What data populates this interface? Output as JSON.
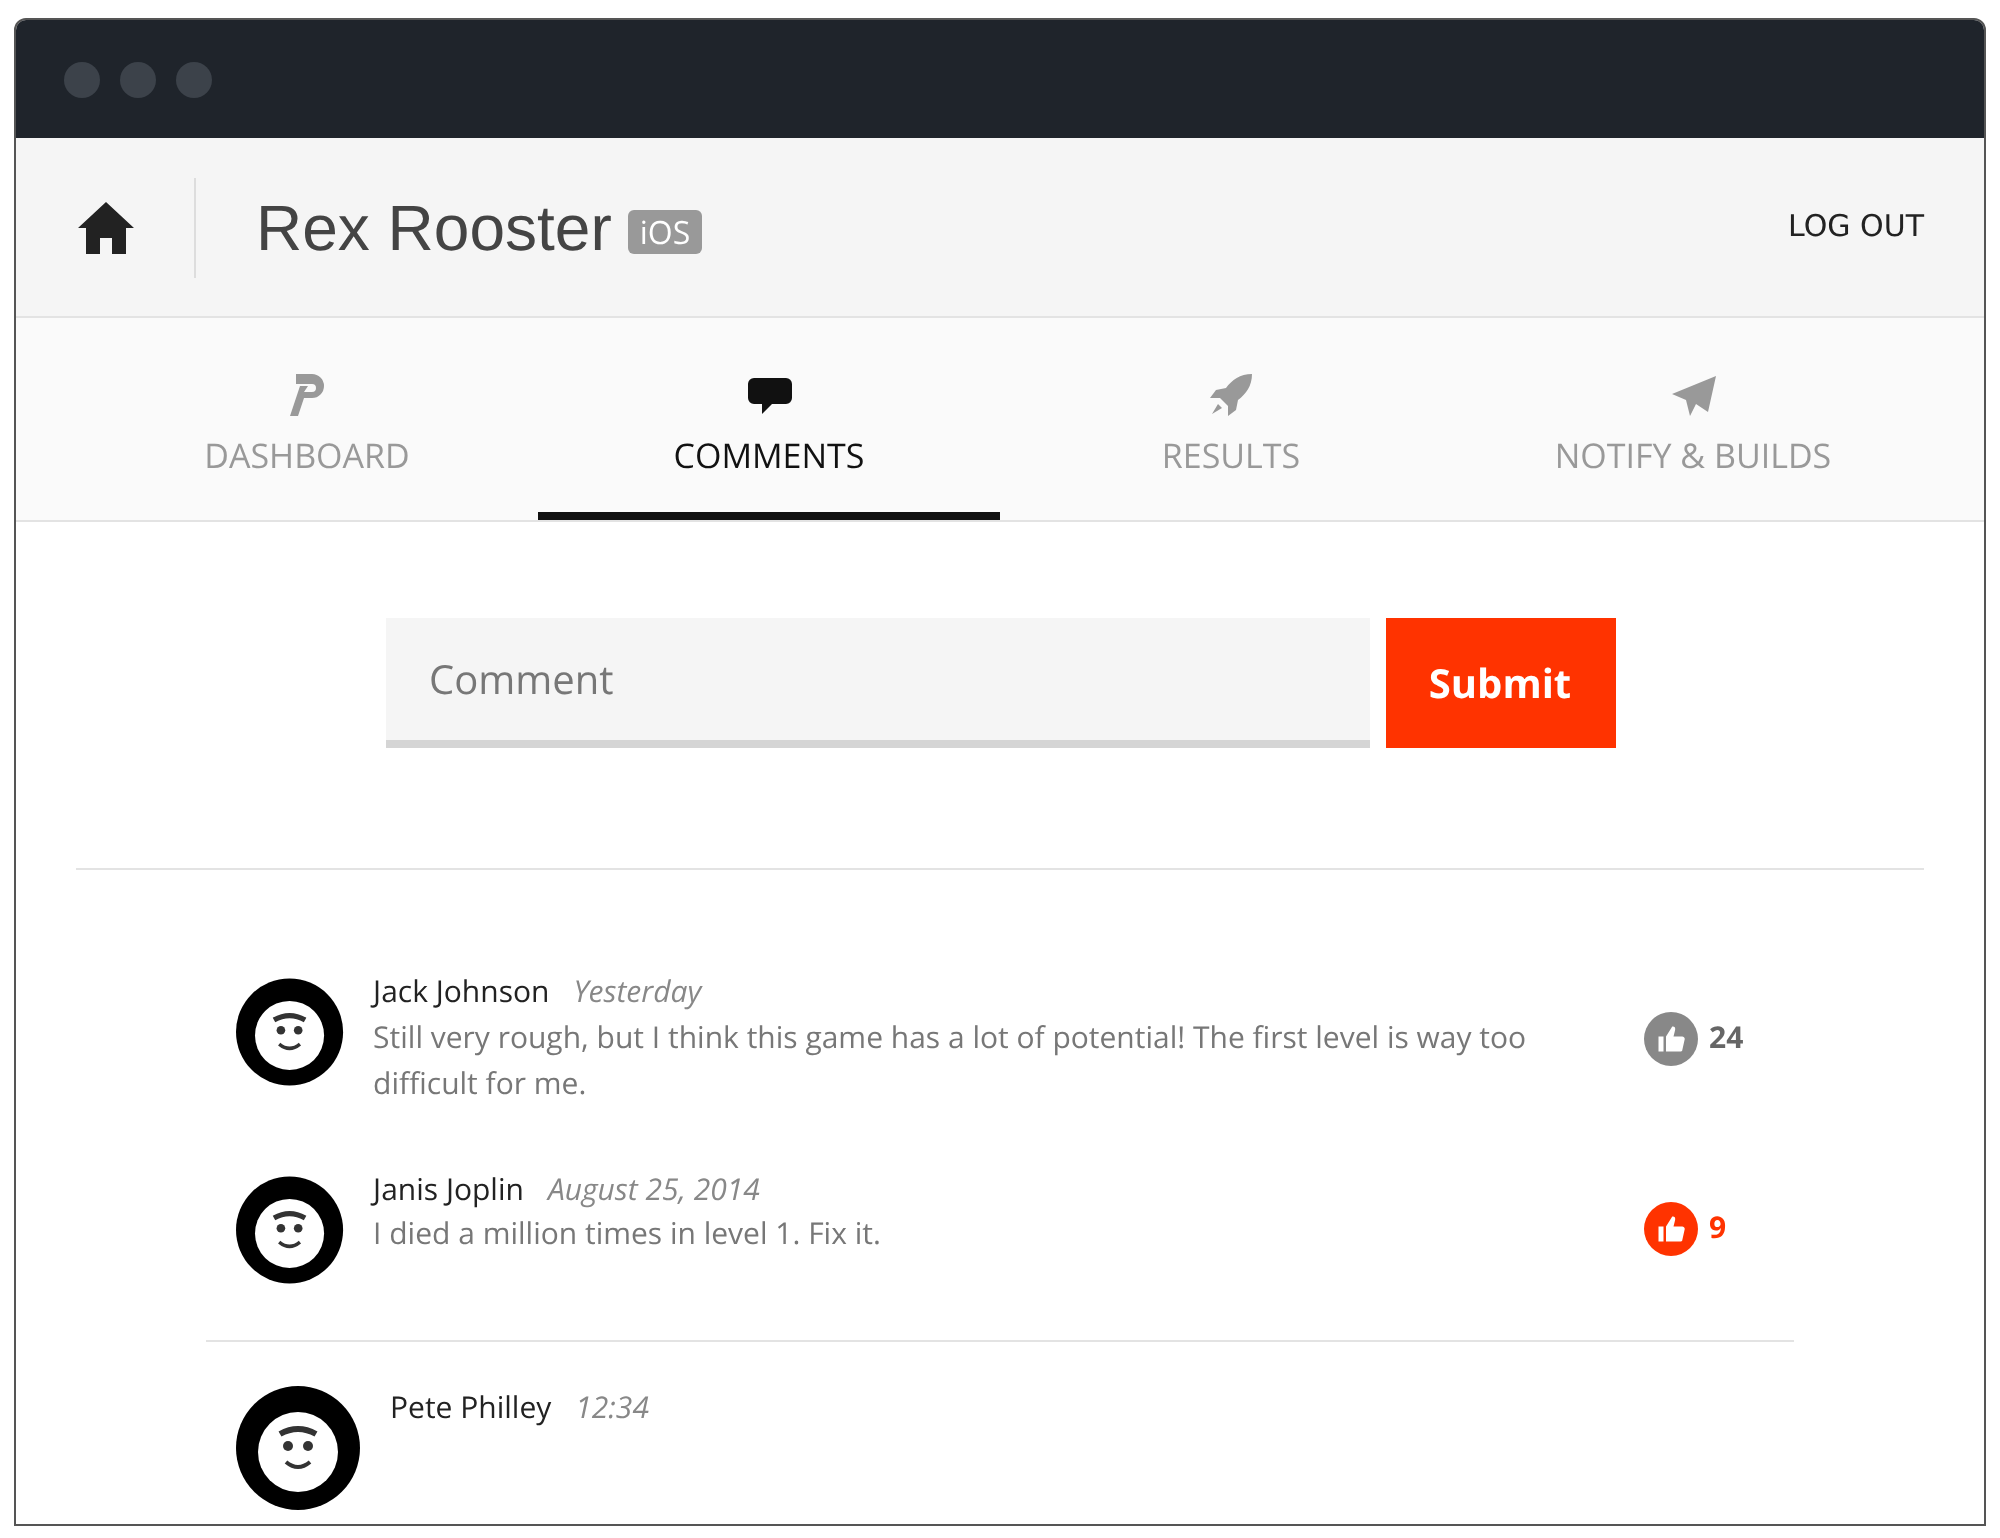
{
  "header": {
    "title": "Rex Rooster",
    "platform": "iOS",
    "logout": "LOG OUT"
  },
  "tabs": [
    {
      "label": "DASHBOARD",
      "kind": "p",
      "selected": false
    },
    {
      "label": "COMMENTS",
      "kind": "chat",
      "selected": true
    },
    {
      "label": "RESULTS",
      "kind": "rocket",
      "selected": false
    },
    {
      "label": "NOTIFY & BUILDS",
      "kind": "plane",
      "selected": false
    }
  ],
  "comment_form": {
    "placeholder": "Comment",
    "submit": "Submit"
  },
  "comments": [
    {
      "author": "Jack Johnson",
      "time": "Yesterday",
      "text": "Still very rough, but I think this game has a lot of potential! The first level is way too difficult for me.",
      "liked": false,
      "likes": "24"
    },
    {
      "author": "Janis Joplin",
      "time": "August 25, 2014",
      "text": "I died a million times in level 1. Fix it.",
      "liked": true,
      "likes": "9"
    },
    {
      "author": "Pete Philley",
      "time": "12:34"
    }
  ]
}
